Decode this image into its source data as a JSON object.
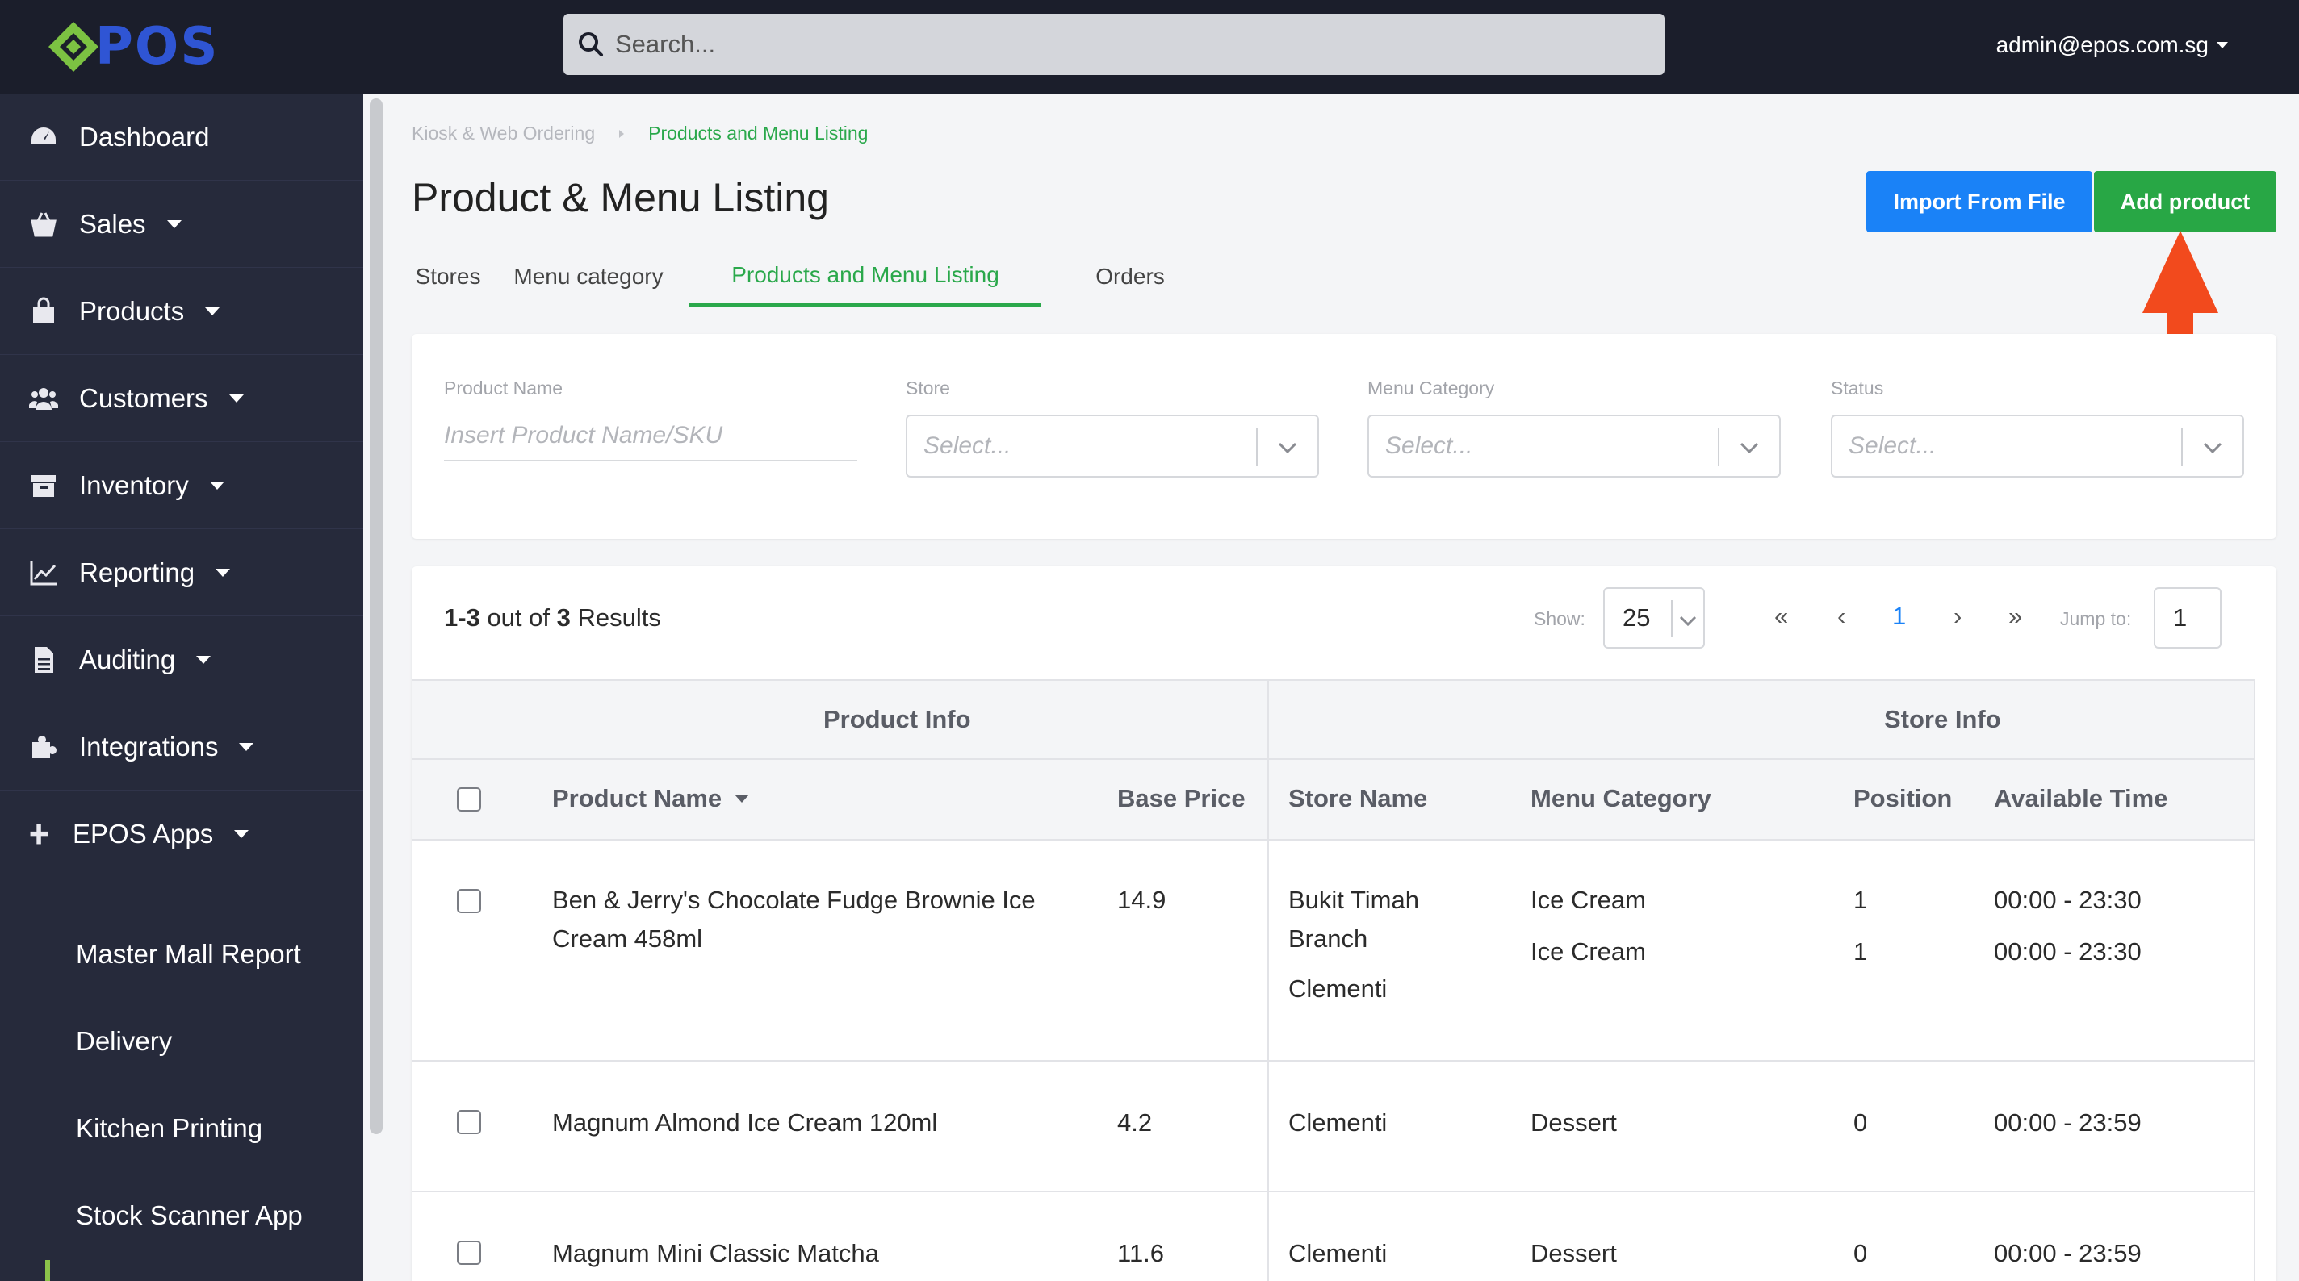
{
  "header": {
    "logo_text": "POS",
    "search_placeholder": "Search...",
    "user_email": "admin@epos.com.sg"
  },
  "sidebar": {
    "items": [
      {
        "label": "Dashboard",
        "icon": "dashboard-icon",
        "has_caret": false
      },
      {
        "label": "Sales",
        "icon": "shopping-basket-icon",
        "has_caret": true
      },
      {
        "label": "Products",
        "icon": "shopping-bag-icon",
        "has_caret": true
      },
      {
        "label": "Customers",
        "icon": "users-icon",
        "has_caret": true
      },
      {
        "label": "Inventory",
        "icon": "archive-box-icon",
        "has_caret": true
      },
      {
        "label": "Reporting",
        "icon": "line-chart-icon",
        "has_caret": true
      },
      {
        "label": "Auditing",
        "icon": "file-icon",
        "has_caret": true
      },
      {
        "label": "Integrations",
        "icon": "puzzle-icon",
        "has_caret": true
      },
      {
        "label": "EPOS Apps",
        "icon": "plus-icon",
        "has_caret": true
      }
    ],
    "sub_items": [
      "Master Mall Report",
      "Delivery",
      "Kitchen Printing",
      "Stock Scanner App"
    ]
  },
  "breadcrumb": {
    "parent": "Kiosk & Web Ordering",
    "current": "Products and Menu Listing"
  },
  "page": {
    "title": "Product & Menu Listing",
    "import_button": "Import From File",
    "add_button": "Add product"
  },
  "tabs": [
    {
      "label": "Stores",
      "active": false
    },
    {
      "label": "Menu category",
      "active": false
    },
    {
      "label": "Products and Menu Listing",
      "active": true
    },
    {
      "label": "Orders",
      "active": false
    }
  ],
  "filters": {
    "product_name": {
      "label": "Product Name",
      "placeholder": "Insert Product Name/SKU"
    },
    "store": {
      "label": "Store",
      "placeholder": "Select..."
    },
    "menu_category": {
      "label": "Menu Category",
      "placeholder": "Select..."
    },
    "status": {
      "label": "Status",
      "placeholder": "Select..."
    }
  },
  "results": {
    "range": "1-3",
    "out_of": "out of",
    "total": "3",
    "suffix": "Results",
    "show_label": "Show:",
    "page_size": "25",
    "first": "«",
    "prev": "‹",
    "current_page": "1",
    "next": "›",
    "last": "»",
    "jump_label": "Jump to:",
    "jump_value": "1"
  },
  "table": {
    "group_product_info": "Product Info",
    "group_store_info": "Store Info",
    "columns": {
      "product_name": "Product Name",
      "base_price": "Base Price",
      "store_name": "Store Name",
      "menu_category": "Menu Category",
      "position": "Position",
      "available_time": "Available Time"
    },
    "rows": [
      {
        "product_name_line1": "Ben & Jerry's Chocolate Fudge Brownie Ice",
        "product_name_line2": "Cream 458ml",
        "base_price": "14.9",
        "stores": [
          {
            "store_name_line1": "Bukit Timah",
            "store_name_line2": "Branch",
            "menu_category": "Ice Cream",
            "position": "1",
            "available_time": "00:00 - 23:30"
          },
          {
            "store_name_line1": "Clementi",
            "store_name_line2": "",
            "menu_category": "Ice Cream",
            "position": "1",
            "available_time": "00:00 - 23:30"
          }
        ]
      },
      {
        "product_name_line1": "Magnum Almond Ice Cream 120ml",
        "base_price": "4.2",
        "store_name": "Clementi",
        "menu_category": "Dessert",
        "position": "0",
        "available_time": "00:00 - 23:59"
      },
      {
        "product_name_line1": "Magnum Mini Classic Matcha",
        "base_price": "11.6",
        "store_name": "Clementi",
        "menu_category": "Dessert",
        "position": "0",
        "available_time": "00:00 - 23:59"
      }
    ]
  },
  "colors": {
    "topbar": "#1b1e2b",
    "sidebar": "#262a3b",
    "accent_green": "#28a745",
    "accent_blue": "#1a82f7",
    "arrow_red": "#f24a1d"
  }
}
